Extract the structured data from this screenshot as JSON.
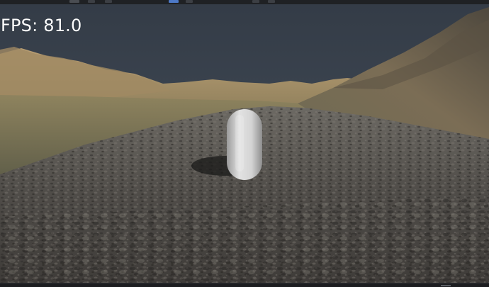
{
  "hud": {
    "fps_label": "FPS: 81.0"
  },
  "scene": {
    "sky_color": "#3b4450",
    "ground_color": "#55524e",
    "hill_color": "#a58e67",
    "capsule_color": "#d9d9d9",
    "object": "capsule-icon"
  },
  "toolbar": {
    "icons": [
      "toolbar-icon",
      "toolbar-icon",
      "toolbar-icon",
      "toolbar-icon",
      "toolbar-icon",
      "toolbar-icon"
    ]
  }
}
